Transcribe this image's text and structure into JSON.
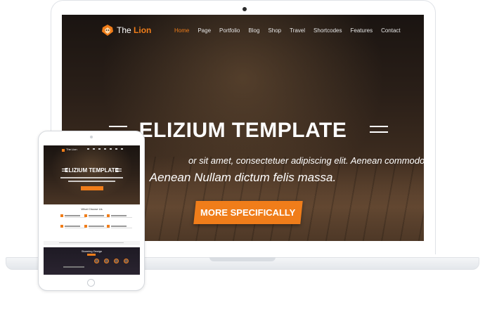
{
  "site": {
    "logo": {
      "prefix": "The",
      "highlight": "Lion"
    },
    "nav": {
      "items": [
        {
          "label": "Home",
          "active": true
        },
        {
          "label": "Page",
          "active": false
        },
        {
          "label": "Portfolio",
          "active": false
        },
        {
          "label": "Blog",
          "active": false
        },
        {
          "label": "Shop",
          "active": false
        },
        {
          "label": "Travel",
          "active": false
        },
        {
          "label": "Shortcodes",
          "active": false
        },
        {
          "label": "Features",
          "active": false
        },
        {
          "label": "Contact",
          "active": false
        }
      ]
    },
    "hero": {
      "title": "ELIZIUM TEMPLATE",
      "line1": "or sit amet, consectetuer adipiscing elit. Aenean commodo ligula eget dolor.",
      "line2": "Aenean Nullam dictum felis massa.",
      "cta": "MORE SPECIFICALLY"
    }
  },
  "tablet": {
    "logo": "The Lion",
    "hero_title": "ELIZIUM TEMPLATE",
    "section_title": "What Choose Us",
    "dark_title": "Stunning Design"
  },
  "colors": {
    "accent": "#f07d1a",
    "hero_bg": "#2a1f18",
    "device_frame": "#ffffff",
    "device_border": "#dfe2e7"
  }
}
